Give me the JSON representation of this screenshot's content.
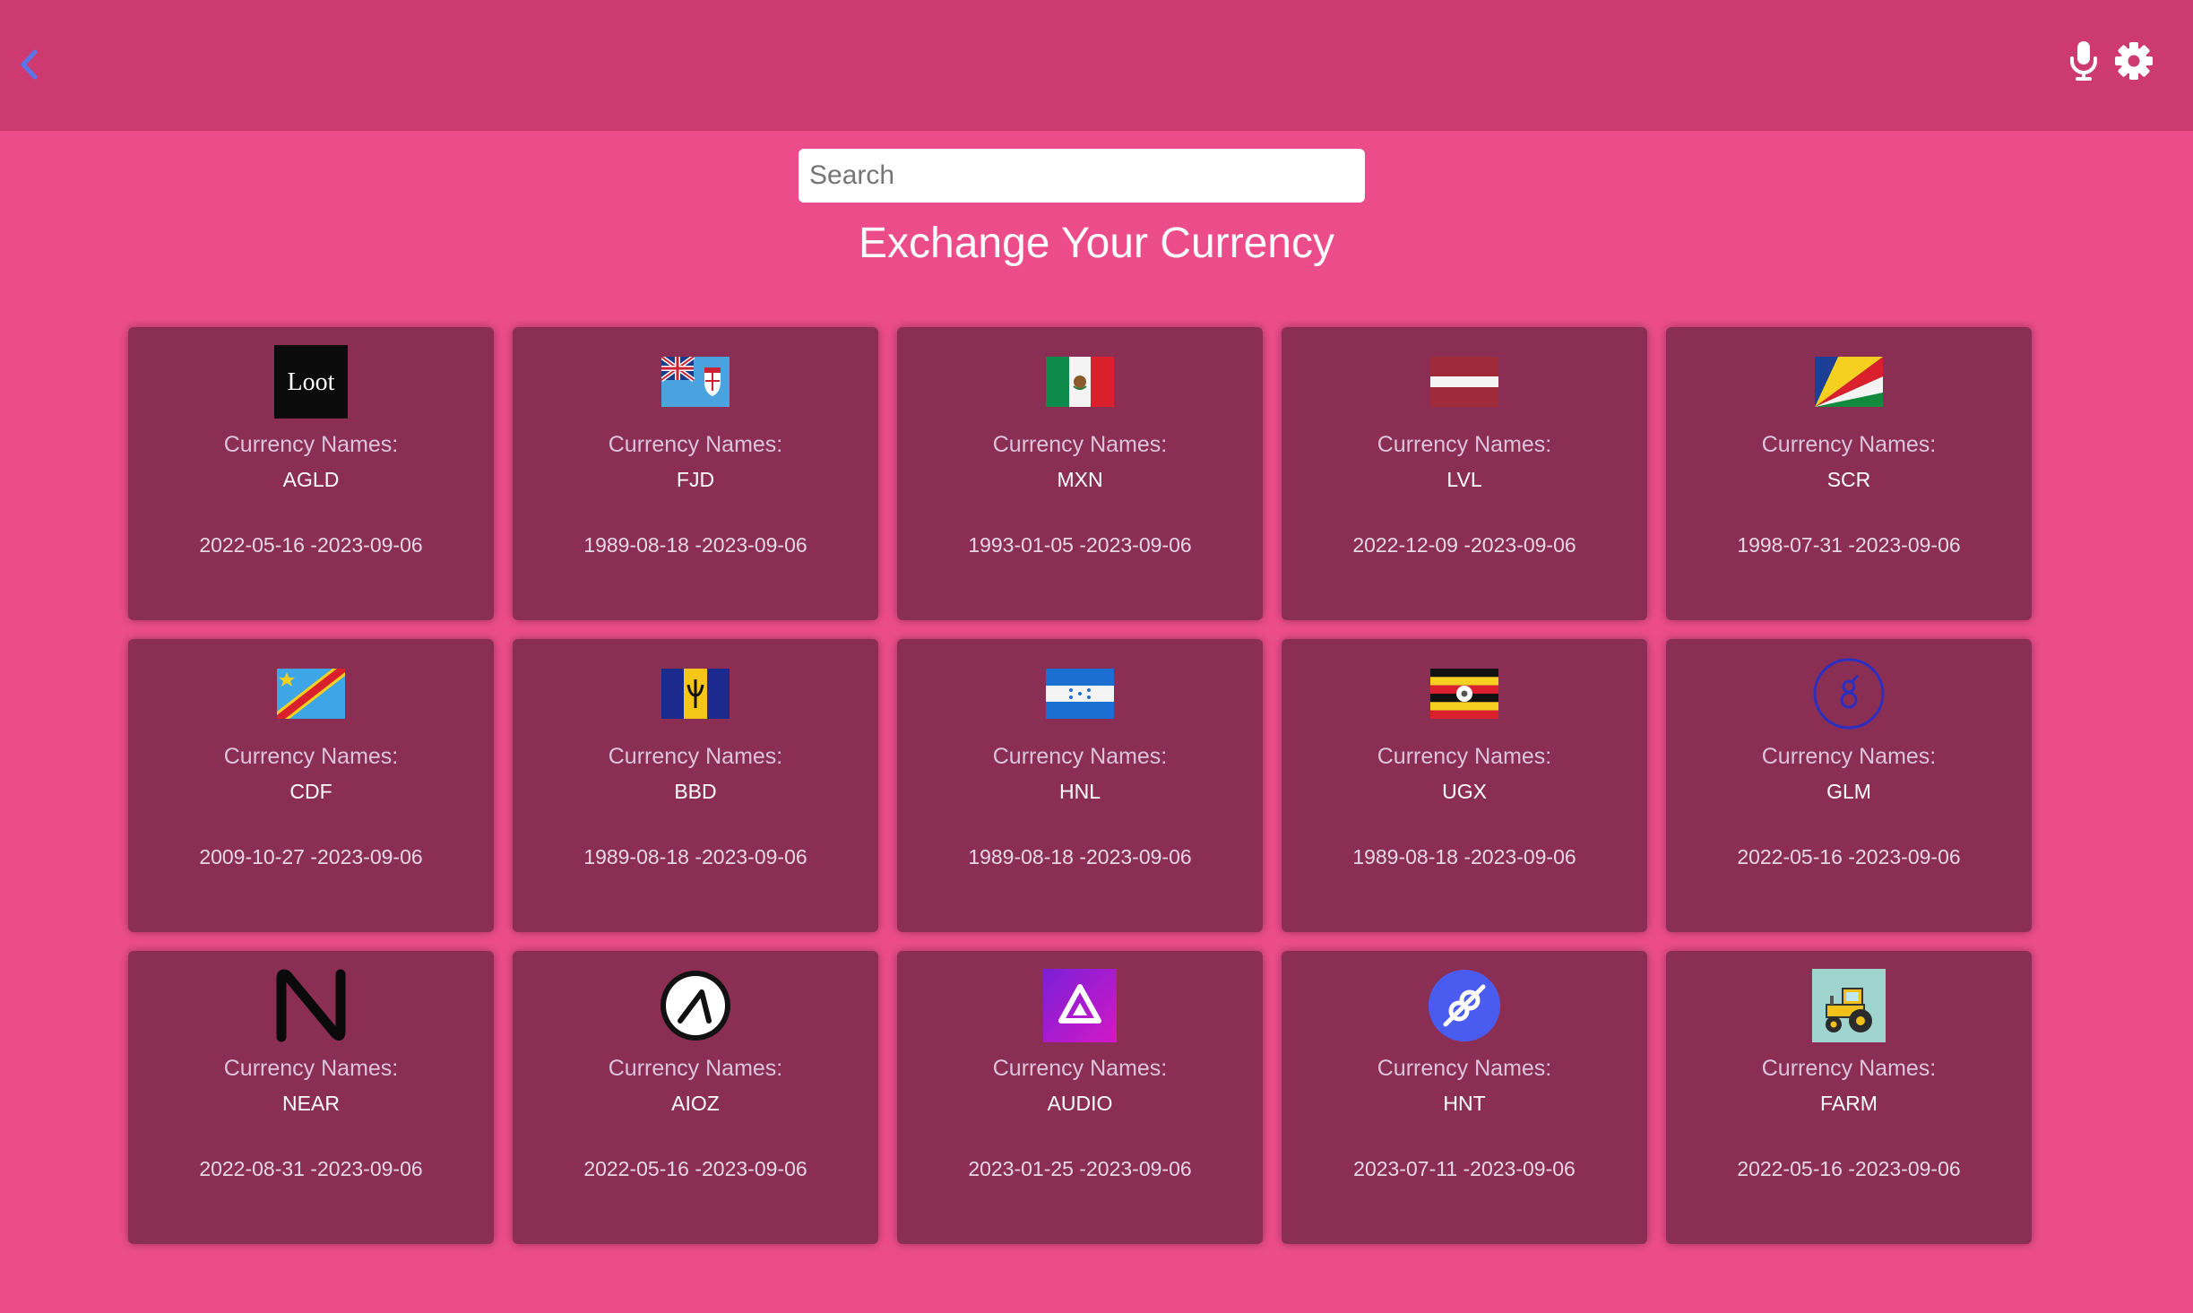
{
  "header": {
    "back_icon": "chevron-left-icon",
    "mic_icon": "microphone-icon",
    "settings_icon": "gear-icon"
  },
  "search": {
    "placeholder": "Search",
    "value": ""
  },
  "page_title": "Exchange Your Currency",
  "colors": {
    "background": "#ec4d8a",
    "header": "#cc3a6f",
    "card": "#8b2e53",
    "back_icon": "#5b74e6"
  },
  "currencies": [
    {
      "label": "Currency Names:",
      "code": "AGLD",
      "dates": "2022-05-16 -2023-09-06",
      "icon": "loot-logo",
      "logo_text": "Loot"
    },
    {
      "label": "Currency Names:",
      "code": "FJD",
      "dates": "1989-08-18 -2023-09-06",
      "icon": "fiji-flag"
    },
    {
      "label": "Currency Names:",
      "code": "MXN",
      "dates": "1993-01-05 -2023-09-06",
      "icon": "mexico-flag"
    },
    {
      "label": "Currency Names:",
      "code": "LVL",
      "dates": "2022-12-09 -2023-09-06",
      "icon": "latvia-flag"
    },
    {
      "label": "Currency Names:",
      "code": "SCR",
      "dates": "1998-07-31 -2023-09-06",
      "icon": "seychelles-flag"
    },
    {
      "label": "Currency Names:",
      "code": "CDF",
      "dates": "2009-10-27 -2023-09-06",
      "icon": "dr-congo-flag"
    },
    {
      "label": "Currency Names:",
      "code": "BBD",
      "dates": "1989-08-18 -2023-09-06",
      "icon": "barbados-flag"
    },
    {
      "label": "Currency Names:",
      "code": "HNL",
      "dates": "1989-08-18 -2023-09-06",
      "icon": "honduras-flag"
    },
    {
      "label": "Currency Names:",
      "code": "UGX",
      "dates": "1989-08-18 -2023-09-06",
      "icon": "uganda-flag"
    },
    {
      "label": "Currency Names:",
      "code": "GLM",
      "dates": "2022-05-16 -2023-09-06",
      "icon": "golem-logo"
    },
    {
      "label": "Currency Names:",
      "code": "NEAR",
      "dates": "2022-08-31 -2023-09-06",
      "icon": "near-logo"
    },
    {
      "label": "Currency Names:",
      "code": "AIOZ",
      "dates": "2022-05-16 -2023-09-06",
      "icon": "aioz-logo"
    },
    {
      "label": "Currency Names:",
      "code": "AUDIO",
      "dates": "2023-01-25 -2023-09-06",
      "icon": "audius-logo"
    },
    {
      "label": "Currency Names:",
      "code": "HNT",
      "dates": "2023-07-11 -2023-09-06",
      "icon": "helium-logo"
    },
    {
      "label": "Currency Names:",
      "code": "FARM",
      "dates": "2022-05-16 -2023-09-06",
      "icon": "tractor-logo"
    }
  ]
}
